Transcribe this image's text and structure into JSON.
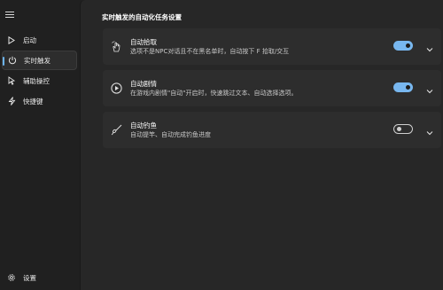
{
  "sidebar": {
    "items": [
      {
        "label": "启动",
        "icon": "play-icon"
      },
      {
        "label": "实时触发",
        "icon": "power-icon",
        "active": true
      },
      {
        "label": "辅助操控",
        "icon": "cursor-icon"
      },
      {
        "label": "快捷键",
        "icon": "lightning-icon"
      }
    ],
    "settings_label": "设置"
  },
  "main": {
    "section_title": "实时触发的自动化任务设置",
    "cards": [
      {
        "title": "自动拾取",
        "desc": "选项不是NPC对话且不在黑名单时，自动按下 F 拾取/交互",
        "icon": "hand-icon",
        "toggle_on": true
      },
      {
        "title": "自动剧情",
        "desc": "在游戏内剧情\"自动\"开启时，快速跳过文本、自动选择选项。",
        "icon": "play-circle-icon",
        "toggle_on": true
      },
      {
        "title": "自动钓鱼",
        "desc": "自动提竿、自动完成钓鱼进度",
        "icon": "fishing-icon",
        "toggle_on": false
      }
    ]
  },
  "colors": {
    "accent": "#78b7ef",
    "background": "#202020",
    "panel": "#272727",
    "card": "#2d2d2d"
  }
}
